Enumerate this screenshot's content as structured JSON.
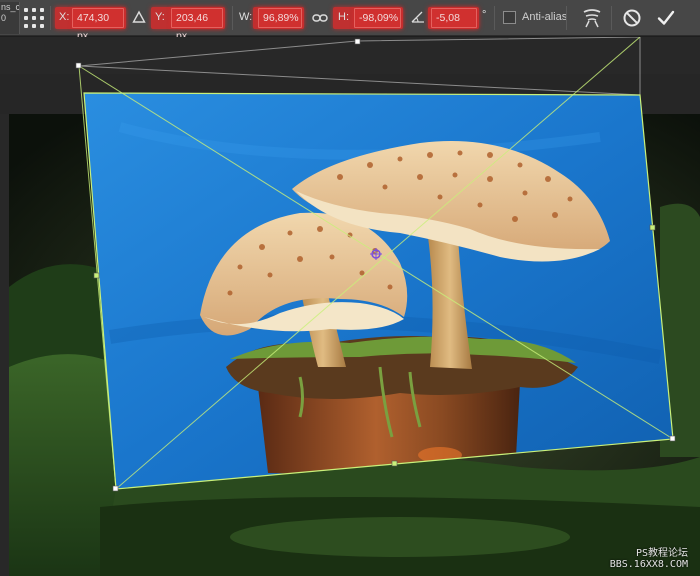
{
  "doc_tab": {
    "text": "ns_c\n0"
  },
  "options_bar": {
    "x": {
      "label": "X:",
      "value": "474,30 px"
    },
    "y": {
      "label": "Y:",
      "value": "203,46 px"
    },
    "w": {
      "label": "W:",
      "value": "96,89%"
    },
    "h": {
      "label": "H:",
      "value": "-98,09%"
    },
    "angle": {
      "value": "-5,08",
      "unit": "°"
    },
    "anti_alias_label": "Anti-alias",
    "anti_alias_checked": false
  },
  "icons": {
    "reference_point": "reference-point-grid-icon",
    "relative_position": "delta-triangle-icon",
    "link": "link-icon",
    "angle": "angle-icon",
    "warp": "warp-mode-icon",
    "cancel": "cancel-transform-icon",
    "commit": "commit-transform-icon"
  },
  "colors": {
    "highlight": "#d0302f",
    "backdrop_blue": "#1f7fd4",
    "transform_guide": "#c9f07a"
  },
  "watermark": {
    "line1": "PS教程论坛",
    "line2": "BBS.16XX8.COM"
  }
}
